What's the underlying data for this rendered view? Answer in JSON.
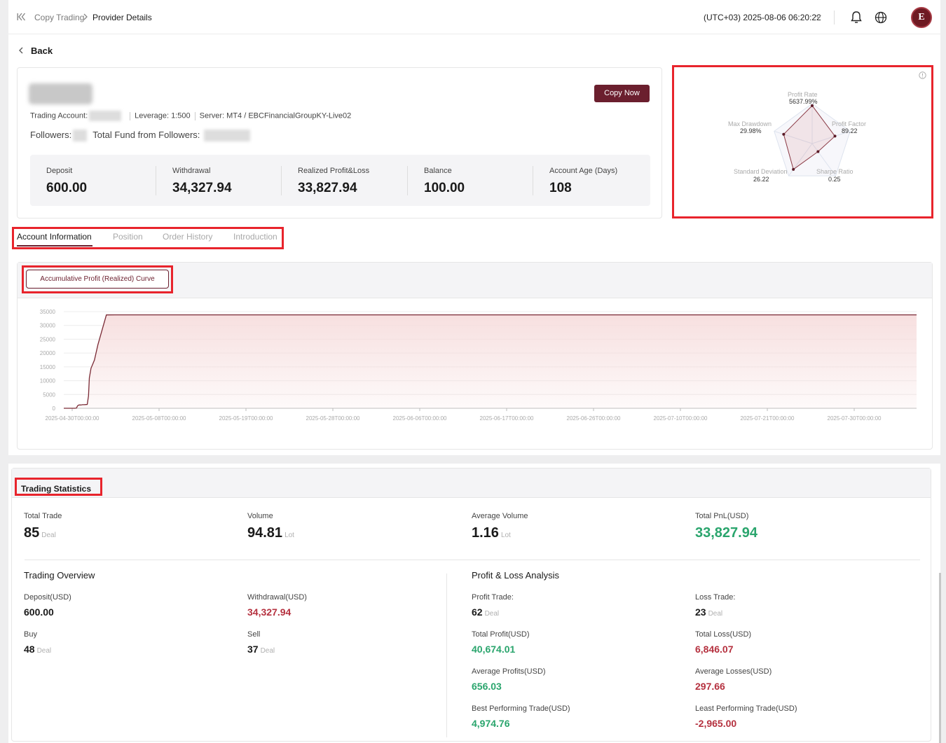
{
  "breadcrumb": {
    "home": "Copy Trading",
    "current": "Provider Details"
  },
  "header": {
    "timezone_datetime": "(UTC+03)  2025-08-06 06:20:22"
  },
  "avatar": {
    "text": "E"
  },
  "back_label": "Back",
  "provider": {
    "copy_button": "Copy Now",
    "trading_account_label": "Trading Account:",
    "leverage": "Leverage: 1:500",
    "server": "Server: MT4 / EBCFinancialGroupKY-Live02",
    "followers_label": "Followers:",
    "total_fund_label": "Total Fund from Followers:",
    "stats": [
      {
        "label": "Deposit",
        "value": "600.00"
      },
      {
        "label": "Withdrawal",
        "value": "34,327.94"
      },
      {
        "label": "Realized Profit&Loss",
        "value": "33,827.94"
      },
      {
        "label": "Balance",
        "value": "100.00"
      },
      {
        "label": "Account Age (Days)",
        "value": "108"
      }
    ]
  },
  "radar": {
    "metrics": [
      {
        "label": "Profit Rate",
        "value": "5637.99%"
      },
      {
        "label": "Profit Factor",
        "value": "89.22"
      },
      {
        "label": "Sharpe Ratio",
        "value": "0.25"
      },
      {
        "label": "Standard Deviation",
        "value": "26.22"
      },
      {
        "label": "Max Drawdown",
        "value": "29.98%"
      }
    ],
    "levels": [
      0.95,
      0.6,
      0.25,
      0.8,
      0.75
    ]
  },
  "tabs": [
    {
      "label": "Account Information",
      "active": true
    },
    {
      "label": "Position",
      "active": false
    },
    {
      "label": "Order History",
      "active": false
    },
    {
      "label": "Introduction",
      "active": false
    }
  ],
  "curve_button": "Accumulative Profit (Realized) Curve",
  "chart_data": {
    "type": "area",
    "title": "",
    "xlabel": "",
    "ylabel": "",
    "ylim": [
      0,
      35000
    ],
    "yticks": [
      0,
      5000,
      10000,
      15000,
      20000,
      25000,
      30000,
      35000
    ],
    "xtick_labels": [
      "2025-04-30T00:00:00",
      "2025-05-08T00:00:00",
      "2025-05-19T00:00:00",
      "2025-05-28T00:00:00",
      "2025-06-06T00:00:00",
      "2025-06-17T00:00:00",
      "2025-06-26T00:00:00",
      "2025-07-10T00:00:00",
      "2025-07-21T00:00:00",
      "2025-07-30T00:00:00"
    ],
    "grid": true,
    "colors": {
      "line": "#7a2a35",
      "fill": "#f6dcdc"
    },
    "series": [
      {
        "x": [
          0,
          0.5,
          1,
          1.3,
          1.5,
          1.6,
          1.7,
          1.8,
          1.95,
          2.1,
          2.2,
          2.4,
          2.6,
          2.75,
          2.9,
          3.0,
          3.2,
          3.4,
          3.6,
          4,
          5,
          6,
          7,
          8,
          9,
          10,
          11,
          12,
          13,
          14,
          15,
          16,
          17,
          18,
          19,
          20,
          21,
          22,
          23,
          24,
          25,
          26,
          27,
          28,
          29,
          30,
          31,
          32,
          33,
          34,
          35,
          36,
          37,
          38,
          39,
          40,
          41,
          42,
          43,
          44,
          45,
          46,
          47,
          48,
          49,
          50,
          51,
          52,
          53,
          54,
          55,
          56,
          57,
          58,
          59,
          60,
          61,
          62,
          63,
          64,
          65,
          66,
          67,
          68,
          69,
          70,
          71,
          72,
          73,
          74,
          75,
          76,
          77,
          78,
          79,
          80,
          81,
          82,
          83,
          84,
          85,
          86,
          87,
          88,
          89,
          90,
          91,
          92,
          93,
          94,
          95,
          96,
          97,
          98,
          99,
          100
        ],
        "values": [
          0,
          0,
          0,
          0,
          100,
          800,
          1100,
          1200,
          1200,
          1250,
          1300,
          1300,
          1350,
          1400,
          4500,
          11000,
          14500,
          16000,
          17500,
          23000,
          33800,
          33827.94,
          33827.94,
          33827.94,
          33827.94,
          33827.94,
          33827.94,
          33827.94,
          33827.94,
          33827.94,
          33827.94,
          33827.94,
          33827.94,
          33827.94,
          33827.94,
          33827.94,
          33827.94,
          33827.94,
          33827.94,
          33827.94,
          33827.94,
          33827.94,
          33827.94,
          33827.94,
          33827.94,
          33827.94,
          33827.94,
          33827.94,
          33827.94,
          33827.94,
          33827.94,
          33827.94,
          33827.94,
          33827.94,
          33827.94,
          33827.94,
          33827.94,
          33827.94,
          33827.94,
          33827.94,
          33827.94,
          33827.94,
          33827.94,
          33827.94,
          33827.94,
          33827.94,
          33827.94,
          33827.94,
          33827.94,
          33827.94,
          33827.94,
          33827.94,
          33827.94,
          33827.94,
          33827.94,
          33827.94,
          33827.94,
          33827.94,
          33827.94,
          33827.94,
          33827.94,
          33827.94,
          33827.94,
          33827.94,
          33827.94,
          33827.94,
          33827.94,
          33827.94,
          33827.94,
          33827.94,
          33827.94,
          33827.94,
          33827.94,
          33827.94,
          33827.94,
          33827.94,
          33827.94,
          33827.94,
          33827.94,
          33827.94,
          33827.94,
          33827.94,
          33827.94,
          33827.94,
          33827.94,
          33827.94,
          33827.94,
          33827.94,
          33827.94,
          33827.94,
          33827.94,
          33827.94,
          33827.94,
          33827.94,
          33827.94,
          33827.94
        ]
      }
    ]
  },
  "trading_statistics": {
    "title": "Trading Statistics",
    "kpis": [
      {
        "label": "Total Trade",
        "value": "85",
        "unit": "Deal"
      },
      {
        "label": "Volume",
        "value": "94.81",
        "unit": "Lot"
      },
      {
        "label": "Average Volume",
        "value": "1.16",
        "unit": "Lot"
      },
      {
        "label": "Total PnL(USD)",
        "value": "33,827.94",
        "unit": ""
      }
    ],
    "overview": {
      "title": "Trading Overview",
      "deposit_label": "Deposit(USD)",
      "deposit": "600.00",
      "withdrawal_label": "Withdrawal(USD)",
      "withdrawal": "34,327.94",
      "buy_label": "Buy",
      "buy": "48",
      "sell_label": "Sell",
      "sell": "37",
      "unit": "Deal"
    },
    "pnl": {
      "title": "Profit & Loss Analysis",
      "profit_trade_label": "Profit Trade:",
      "profit_trade": "62",
      "loss_trade_label": "Loss Trade:",
      "loss_trade": "23",
      "unit": "Deal",
      "total_profit_label": "Total Profit(USD)",
      "total_profit": "40,674.01",
      "total_loss_label": "Total Loss(USD)",
      "total_loss": "6,846.07",
      "avg_profit_label": "Average Profits(USD)",
      "avg_profit": "656.03",
      "avg_loss_label": "Average Losses(USD)",
      "avg_loss": "297.66",
      "best_label": "Best Performing Trade(USD)",
      "best": "4,974.76",
      "least_label": "Least Performing Trade(USD)",
      "least": "-2,965.00"
    }
  }
}
